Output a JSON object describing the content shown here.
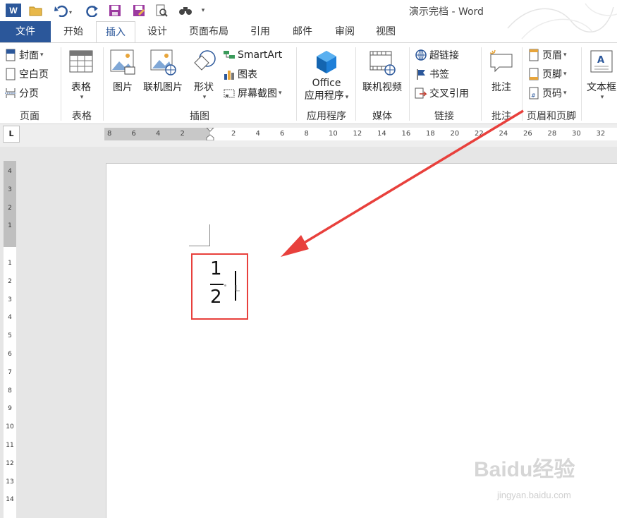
{
  "window": {
    "title": "演示完档 - Word"
  },
  "tabs": [
    "文件",
    "开始",
    "插入",
    "设计",
    "页面布局",
    "引用",
    "邮件",
    "审阅",
    "视图"
  ],
  "active_tab": "插入",
  "ribbon": {
    "pages": {
      "cover": "封面",
      "blank": "空白页",
      "break": "分页",
      "label": "页面"
    },
    "tables": {
      "table": "表格",
      "label": "表格"
    },
    "illustrations": {
      "picture": "图片",
      "online_picture": "联机图片",
      "shapes": "形状",
      "smartart": "SmartArt",
      "chart": "图表",
      "screenshot": "屏幕截图",
      "label": "插图"
    },
    "apps": {
      "office_line1": "Office",
      "office_line2": "应用程序",
      "label": "应用程序"
    },
    "media": {
      "online_video": "联机视频",
      "label": "媒体"
    },
    "links": {
      "hyperlink": "超链接",
      "bookmark": "书签",
      "cross_ref": "交叉引用",
      "label": "链接"
    },
    "comments": {
      "comment": "批注",
      "label": "批注"
    },
    "header_footer": {
      "header": "页眉",
      "footer": "页脚",
      "page_number": "页码",
      "label": "页眉和页脚"
    },
    "text": {
      "textbox": "文本框"
    }
  },
  "ruler": {
    "tab_selector": "L",
    "h_left_ticks": [
      "8",
      "6",
      "4",
      "2"
    ],
    "h_right_ticks": [
      "2",
      "4",
      "6",
      "8",
      "10",
      "12",
      "14",
      "16",
      "18",
      "20",
      "22",
      "24",
      "26",
      "28",
      "30",
      "32"
    ],
    "v_top_ticks": [
      "4",
      "3",
      "2",
      "1"
    ],
    "v_bottom_ticks": [
      "1",
      "2",
      "3",
      "4",
      "5",
      "6",
      "7",
      "8",
      "9",
      "10",
      "11",
      "12",
      "13",
      "14"
    ]
  },
  "document": {
    "fraction_numerator": "1",
    "fraction_denominator": "2"
  },
  "watermark": {
    "brand": "Baidu经验",
    "url": "jingyan.baidu.com"
  },
  "colors": {
    "accent": "#2b579a",
    "highlight": "#e8403c"
  }
}
